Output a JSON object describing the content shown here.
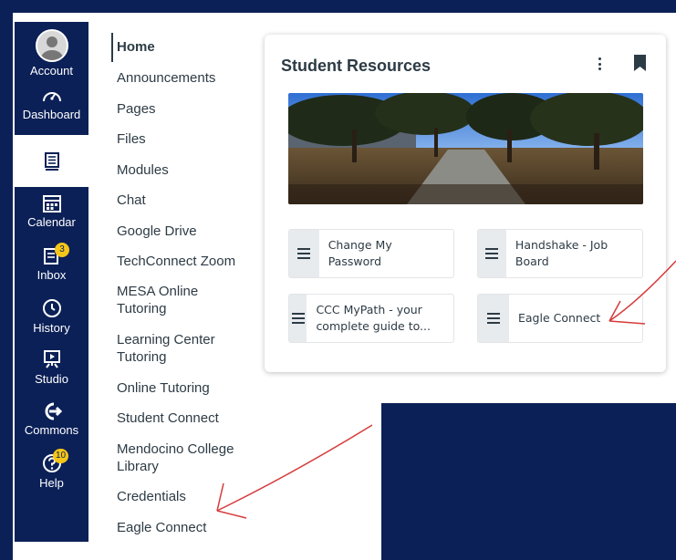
{
  "global_nav": {
    "items": [
      {
        "label": "Account",
        "icon": "user-avatar-icon"
      },
      {
        "label": "Dashboard",
        "icon": "dashboard-gauge-icon"
      },
      {
        "label": "",
        "icon": "courses-book-icon",
        "active": true
      },
      {
        "label": "Calendar",
        "icon": "calendar-icon"
      },
      {
        "label": "Inbox",
        "icon": "inbox-icon",
        "badge": "3"
      },
      {
        "label": "History",
        "icon": "clock-icon"
      },
      {
        "label": "Studio",
        "icon": "studio-icon"
      },
      {
        "label": "Commons",
        "icon": "commons-icon"
      },
      {
        "label": "Help",
        "icon": "help-icon",
        "badge": "10"
      }
    ]
  },
  "course_nav": {
    "items": [
      {
        "label": "Home"
      },
      {
        "label": "Announcements"
      },
      {
        "label": "Pages"
      },
      {
        "label": "Files"
      },
      {
        "label": "Modules"
      },
      {
        "label": "Chat"
      },
      {
        "label": "Google Drive"
      },
      {
        "label": "TechConnect Zoom"
      },
      {
        "label": "MESA Online Tutoring"
      },
      {
        "label": "Learning Center Tutoring"
      },
      {
        "label": "Online Tutoring"
      },
      {
        "label": "Student Connect"
      },
      {
        "label": "Mendocino College Library"
      },
      {
        "label": "Credentials"
      },
      {
        "label": "Eagle Connect"
      }
    ]
  },
  "card": {
    "title": "Student Resources",
    "links": [
      {
        "label": "Change My Password"
      },
      {
        "label": "Handshake - Job Board"
      },
      {
        "label": "CCC MyPath - your complete guide to..."
      },
      {
        "label": "Eagle Connect"
      }
    ]
  },
  "colors": {
    "nav_bg": "#0b2057",
    "text": "#2d3b45",
    "badge": "#f5c518",
    "annotation": "#d63b3b"
  }
}
